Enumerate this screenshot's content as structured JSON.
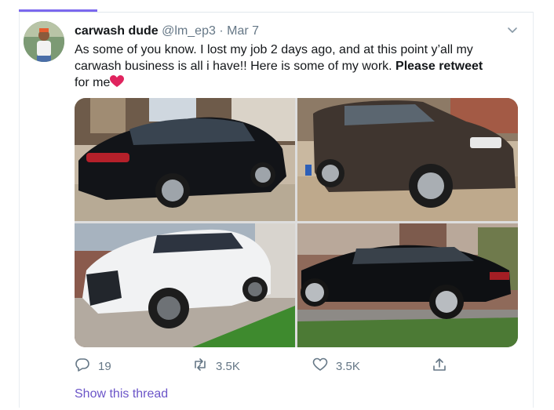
{
  "tweet": {
    "display_name": "carwash dude",
    "handle": "@lm_ep3",
    "separator": "·",
    "date": "Mar 7",
    "text_part1": "As some of you know. I lost my job 2 days ago, and at this point y’all my carwash business is all i have!!  Here is some of my work. ",
    "text_bold": "Please retweet",
    "text_part2": " for me",
    "emoji": "heart-emoji"
  },
  "media": {
    "photos": [
      {
        "subject": "black sedan"
      },
      {
        "subject": "brown SUV"
      },
      {
        "subject": "white SUV"
      },
      {
        "subject": "black luxury sedan"
      }
    ]
  },
  "actions": {
    "replies": "19",
    "retweets": "3.5K",
    "likes": "3.5K"
  },
  "footer": {
    "show_thread": "Show this thread"
  },
  "colors": {
    "accent": "#6b55c8",
    "muted": "#657786",
    "heart": "#e0245e"
  }
}
